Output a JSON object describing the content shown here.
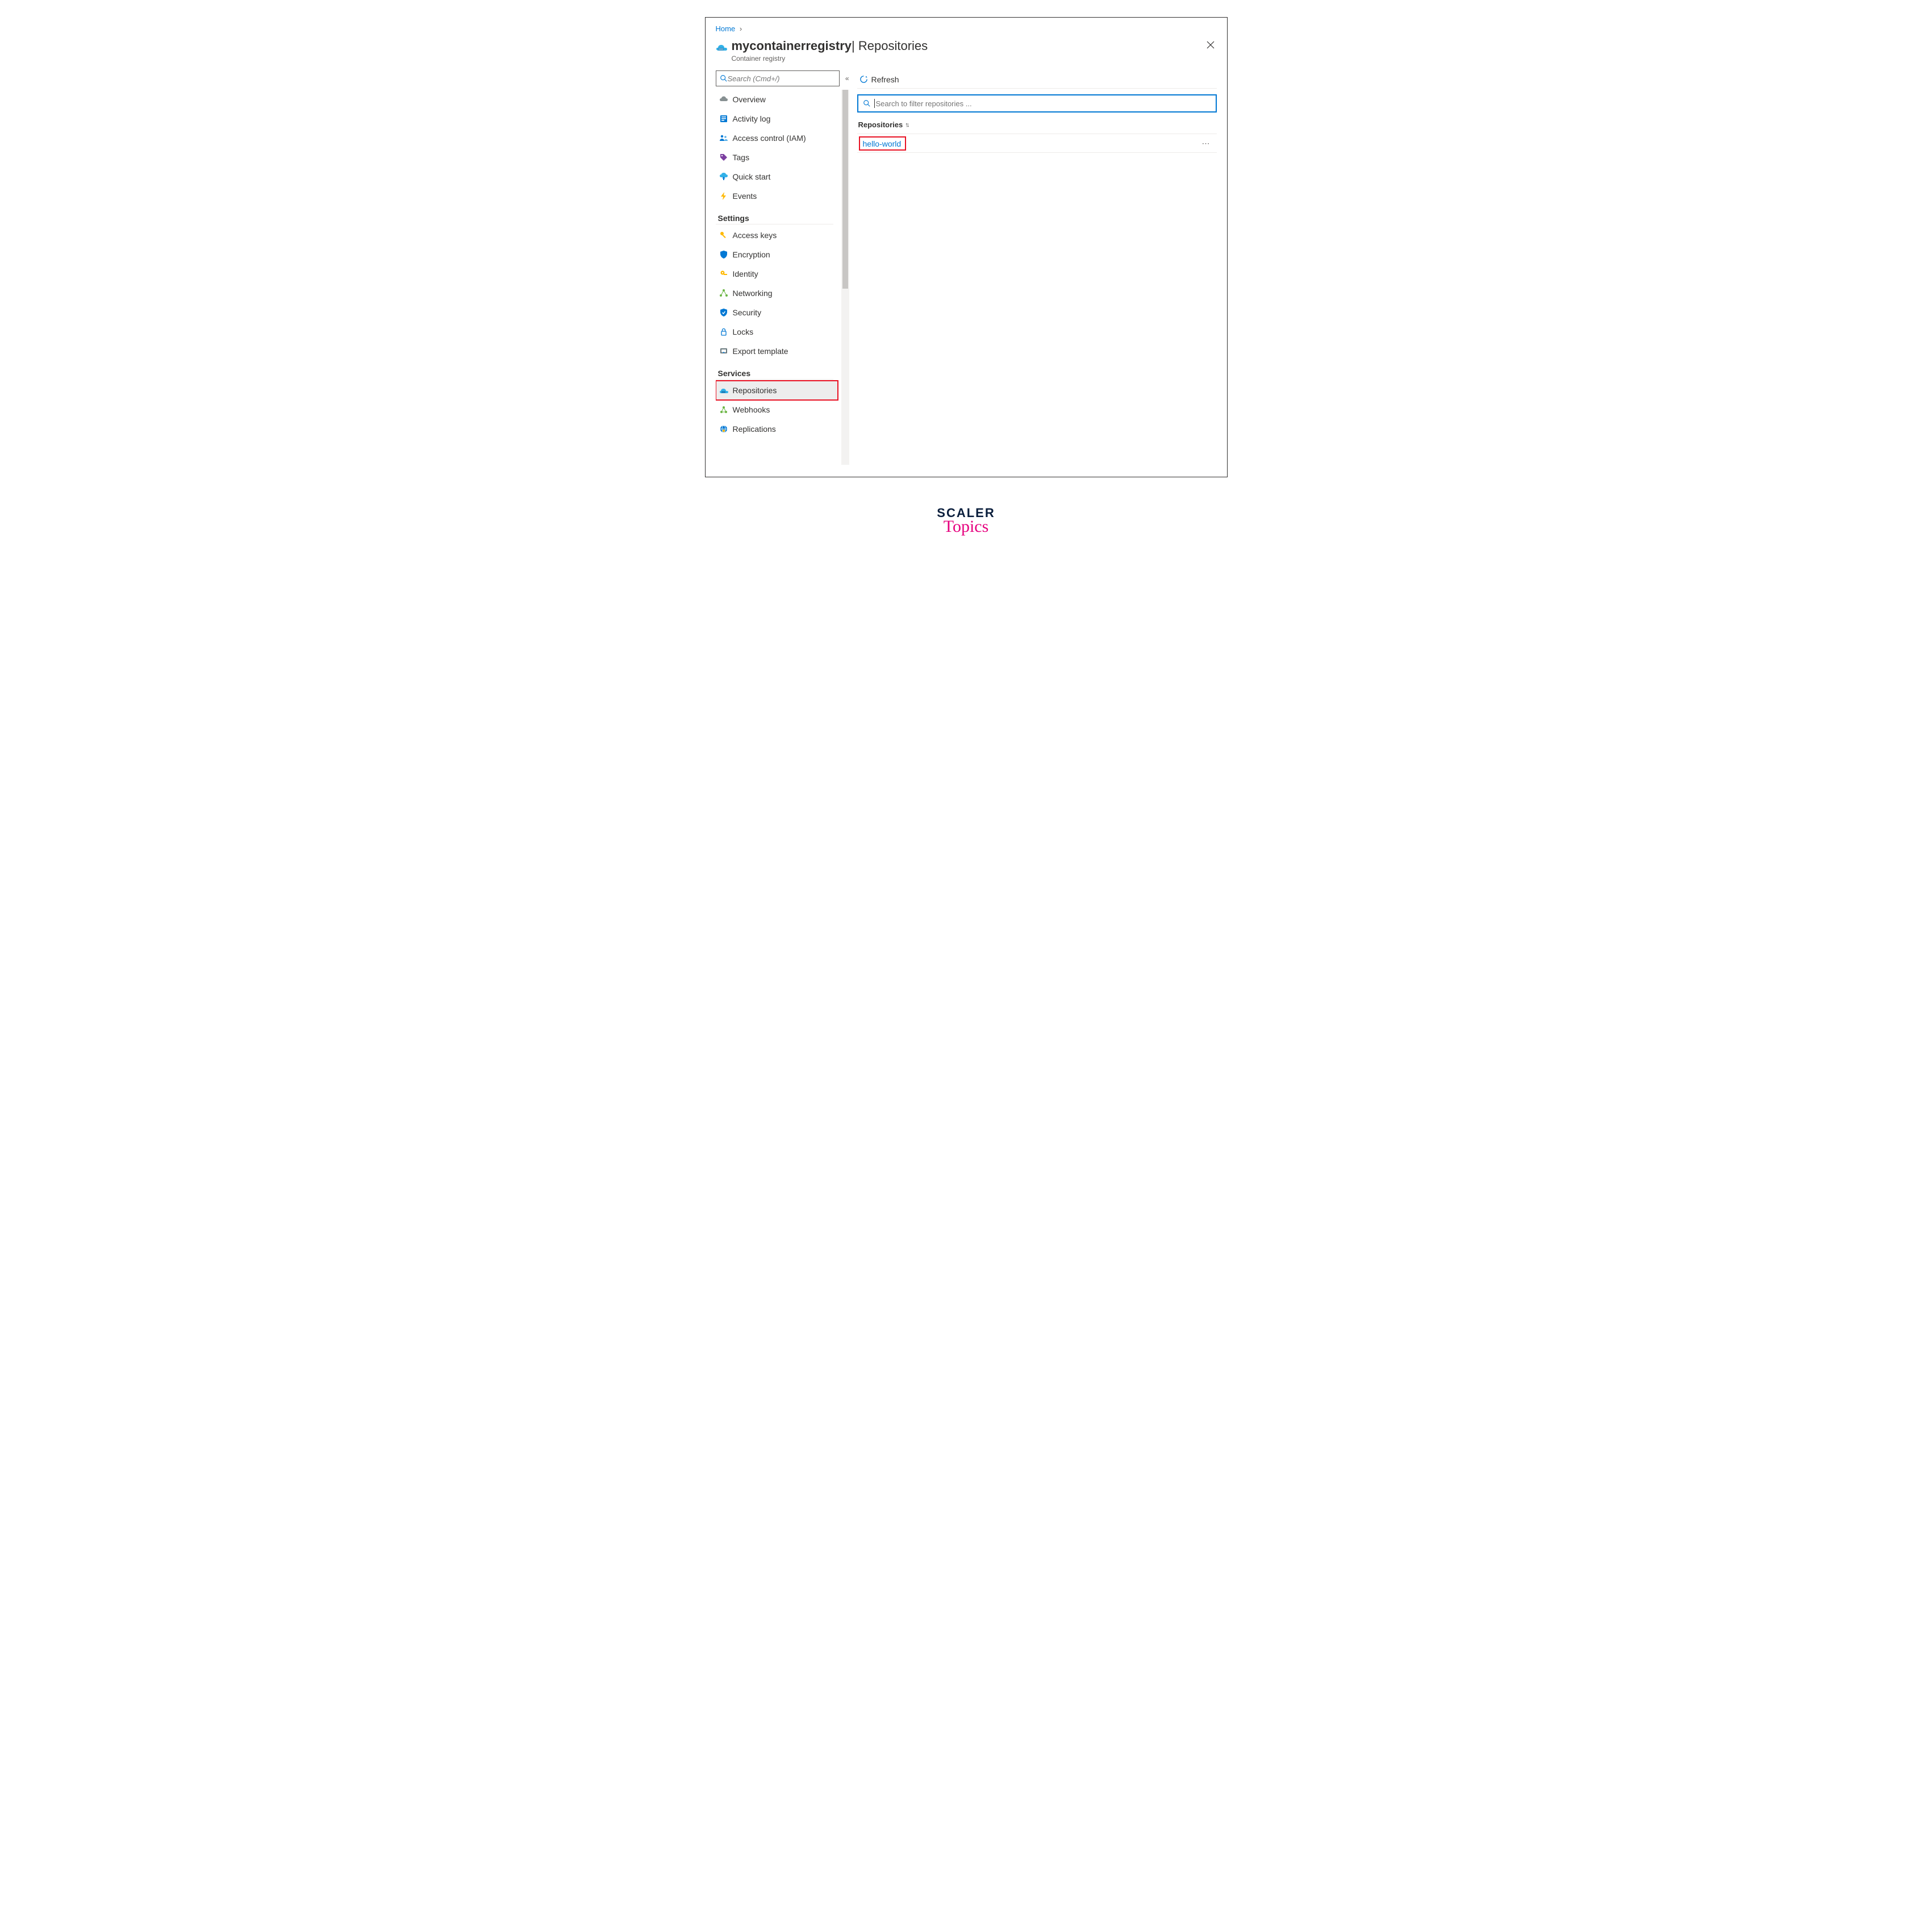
{
  "breadcrumb": {
    "home": "Home"
  },
  "header": {
    "registry_name": "mycontainerregistry",
    "page_title": "Repositories",
    "subtype": "Container registry"
  },
  "sidebar": {
    "search_placeholder": "Search (Cmd+/)",
    "top_items": [
      {
        "label": "Overview",
        "icon": "cloud-icon"
      },
      {
        "label": "Activity log",
        "icon": "log-icon"
      },
      {
        "label": "Access control (IAM)",
        "icon": "people-icon"
      },
      {
        "label": "Tags",
        "icon": "tag-icon"
      },
      {
        "label": "Quick start",
        "icon": "cloud-arrow-icon"
      },
      {
        "label": "Events",
        "icon": "lightning-icon"
      }
    ],
    "section_settings": "Settings",
    "settings_items": [
      {
        "label": "Access keys",
        "icon": "key-icon"
      },
      {
        "label": "Encryption",
        "icon": "shield-icon"
      },
      {
        "label": "Identity",
        "icon": "lock-key-icon"
      },
      {
        "label": "Networking",
        "icon": "network-icon"
      },
      {
        "label": "Security",
        "icon": "shield-check-icon"
      },
      {
        "label": "Locks",
        "icon": "padlock-icon"
      },
      {
        "label": "Export template",
        "icon": "export-icon"
      }
    ],
    "section_services": "Services",
    "services_items": [
      {
        "label": "Repositories",
        "icon": "registry-icon",
        "selected": true
      },
      {
        "label": "Webhooks",
        "icon": "webhook-icon"
      },
      {
        "label": "Replications",
        "icon": "globe-icon"
      }
    ]
  },
  "toolbar": {
    "refresh": "Refresh"
  },
  "filter": {
    "placeholder": "Search to filter repositories ..."
  },
  "list": {
    "header": "Repositories",
    "rows": [
      {
        "name": "hello-world"
      }
    ]
  },
  "footer_logo": {
    "line1": "SCALER",
    "line2": "Topics"
  }
}
